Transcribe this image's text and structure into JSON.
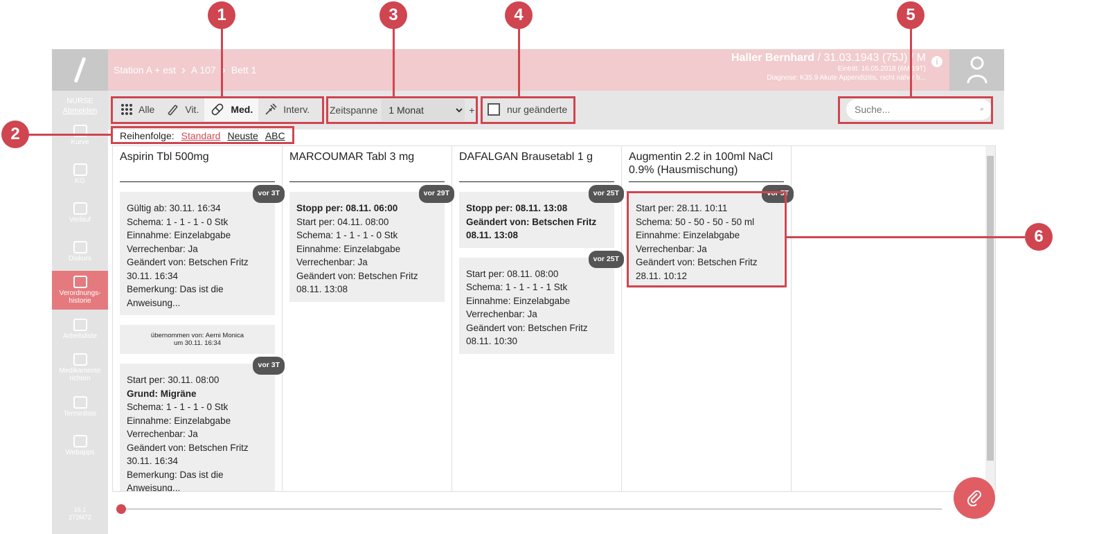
{
  "sidebar": {
    "role": "NURSE",
    "logout": "Abmelden",
    "items": [
      {
        "label": "Kurve",
        "icon": "chart-icon"
      },
      {
        "label": "KG",
        "icon": "document-icon"
      },
      {
        "label": "Verlauf",
        "icon": "clipboard-icon"
      },
      {
        "label": "Diskurs",
        "icon": "chat-icon"
      },
      {
        "label": "Verordnungs-historie",
        "icon": "prescription-history-icon",
        "active": true
      },
      {
        "label": "Arbeitsliste",
        "icon": "checklist-icon"
      },
      {
        "label": "Medikamente richten",
        "icon": "medication-icon"
      },
      {
        "label": "Terminliste",
        "icon": "calendar-icon"
      },
      {
        "label": "Webapps",
        "icon": "webapps-icon"
      }
    ],
    "version": "16.1\n272f472"
  },
  "header": {
    "breadcrumbs": [
      "Station A + est",
      "A 107",
      "Bett 1"
    ],
    "patient_name": "Haller Bernhard",
    "patient_details": " / 31.03.1943 (75J) / M",
    "entry": "Eintritt: 16.05.2018 (6M 19T)",
    "diagnosis": "Diagnose: K35.9 Akute Appendizitis, nicht näher b..."
  },
  "toolbar": {
    "filters": [
      {
        "label": "Alle",
        "icon": "grid-icon"
      },
      {
        "label": "Vit.",
        "icon": "stethoscope-icon"
      },
      {
        "label": "Med.",
        "icon": "pill-icon",
        "active": true
      },
      {
        "label": "Interv.",
        "icon": "syringe-icon"
      }
    ],
    "zeitspanne_label": "Zeitspanne",
    "zeitspanne_value": "1 Monat",
    "plus": "+",
    "only_changed": "nur geänderte",
    "search_placeholder": "Suche..."
  },
  "sort": {
    "label": "Reihenfolge:",
    "options": [
      "Standard",
      "Neuste",
      "ABC"
    ],
    "active": "Standard"
  },
  "columns": [
    {
      "title": "Aspirin Tbl 500mg",
      "cards": [
        {
          "badge": "vor 3T",
          "lines": [
            {
              "t": "Gültig ab: 30.11. 16:34"
            },
            {
              "t": "Schema: 1 - 1 - 1 - 0 Stk"
            },
            {
              "t": "Einnahme: Einzelabgabe"
            },
            {
              "t": "Verrechenbar: Ja"
            },
            {
              "t": "Geändert von: Betschen Fritz 30.11. 16:34"
            },
            {
              "t": "Bemerkung: Das ist die Anweisung..."
            }
          ]
        },
        {
          "note": "übernommen von: Aerni Monica\num 30.11. 16:34"
        },
        {
          "badge": "vor 3T",
          "lines": [
            {
              "t": "Start per: 30.11. 08:00"
            },
            {
              "t": "Grund: Migräne",
              "bold": true
            },
            {
              "t": "Schema: 1 - 1 - 1 - 0 Stk"
            },
            {
              "t": "Einnahme: Einzelabgabe"
            },
            {
              "t": "Verrechenbar: Ja"
            },
            {
              "t": "Geändert von: Betschen Fritz 30.11. 16:34"
            },
            {
              "t": "Bemerkung: Das ist die Anweisung..."
            }
          ]
        }
      ]
    },
    {
      "title": "MARCOUMAR Tabl 3 mg",
      "cards": [
        {
          "badge": "vor 29T",
          "lines": [
            {
              "t": "Stopp per: 08.11. 06:00",
              "bold": true
            },
            {
              "t": "Start per: 04.11. 08:00"
            },
            {
              "t": "Schema: 1 - 1 - 1 - 0 Stk"
            },
            {
              "t": "Einnahme: Einzelabgabe"
            },
            {
              "t": "Verrechenbar: Ja"
            },
            {
              "t": "Geändert von: Betschen Fritz 08.11. 13:08"
            }
          ]
        }
      ]
    },
    {
      "title": "DAFALGAN Brausetabl 1 g",
      "cards": [
        {
          "badge": "vor 25T",
          "lines": [
            {
              "t": "Stopp per: 08.11. 13:08",
              "bold": true
            },
            {
              "t": "Geändert von: Betschen Fritz 08.11. 13:08",
              "bold": true
            }
          ]
        },
        {
          "badge": "vor 25T",
          "lines": [
            {
              "t": "Start per: 08.11. 08:00"
            },
            {
              "t": "Schema: 1 - 1 - 1 - 1 Stk"
            },
            {
              "t": "Einnahme: Einzelabgabe"
            },
            {
              "t": "Verrechenbar: Ja"
            },
            {
              "t": "Geändert von: Betschen Fritz 08.11. 10:30"
            }
          ]
        }
      ]
    },
    {
      "title": "Augmentin 2.2 in 100ml NaCl 0.9% (Hausmischung)",
      "cards": [
        {
          "badge": "vor 5T",
          "lines": [
            {
              "t": "Start per: 28.11. 10:11"
            },
            {
              "t": "Schema: 50 - 50 - 50 - 50 ml"
            },
            {
              "t": "Einnahme: Einzelabgabe"
            },
            {
              "t": "Verrechenbar: Ja"
            },
            {
              "t": "Geändert von: Betschen Fritz 28.11. 10:12"
            }
          ]
        }
      ]
    }
  ],
  "annotations": [
    "1",
    "2",
    "3",
    "4",
    "5",
    "6"
  ],
  "colors": {
    "accent": "#cf4550",
    "header": "#f1cbcd",
    "active_nav": "#e57a7e"
  }
}
